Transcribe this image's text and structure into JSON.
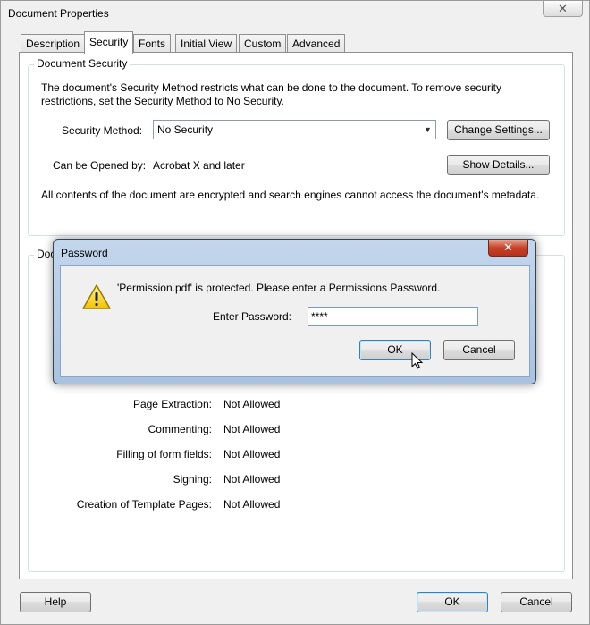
{
  "window": {
    "title": "Document Properties",
    "close_glyph": "✕"
  },
  "tabs": [
    {
      "label": "Description",
      "active": false
    },
    {
      "label": "Security",
      "active": true
    },
    {
      "label": "Fonts",
      "active": false
    },
    {
      "label": "Initial View",
      "active": false
    },
    {
      "label": "Custom",
      "active": false
    },
    {
      "label": "Advanced",
      "active": false
    }
  ],
  "security": {
    "group_title": "Document Security",
    "description": "The document's Security Method restricts what can be done to the document. To remove security restrictions, set the Security Method to No Security.",
    "method_label": "Security Method:",
    "method_value": "No Security",
    "change_settings": "Change Settings...",
    "opened_by_label": "Can be Opened by:",
    "opened_by_value": "Acrobat X and later",
    "show_details": "Show Details...",
    "encryption_note": "All contents of the document are encrypted and search engines cannot access the document's metadata."
  },
  "restrictions": {
    "group_title_partial": "Doc",
    "rows": [
      {
        "label": "Page Extraction:",
        "value": "Not Allowed"
      },
      {
        "label": "Commenting:",
        "value": "Not Allowed"
      },
      {
        "label": "Filling of form fields:",
        "value": "Not Allowed"
      },
      {
        "label": "Signing:",
        "value": "Not Allowed"
      },
      {
        "label": "Creation of Template Pages:",
        "value": "Not Allowed"
      }
    ]
  },
  "footer": {
    "help": "Help",
    "ok": "OK",
    "cancel": "Cancel"
  },
  "password_dialog": {
    "title": "Password",
    "close_glyph": "✕",
    "message": "'Permission.pdf' is protected. Please enter a Permissions Password.",
    "field_label": "Enter Password:",
    "field_value": "****",
    "ok": "OK",
    "cancel": "Cancel",
    "icon": "warning-icon",
    "accent_color": "#c7422a"
  }
}
